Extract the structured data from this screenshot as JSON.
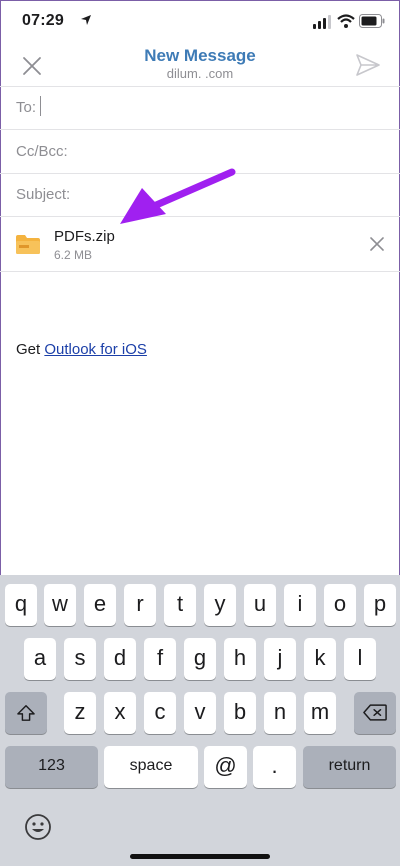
{
  "status_bar": {
    "time": "07:29"
  },
  "header": {
    "title": "New Message",
    "subtitle": "dilum.                   .com"
  },
  "fields": {
    "to_label": "To:",
    "cc_label": "Cc/Bcc:",
    "subject_label": "Subject:"
  },
  "attachment": {
    "name": "PDFs.zip",
    "size": "6.2 MB"
  },
  "signature": {
    "prefix": "Get ",
    "link": "Outlook for iOS"
  },
  "keyboard": {
    "row1": [
      "q",
      "w",
      "e",
      "r",
      "t",
      "y",
      "u",
      "i",
      "o",
      "p"
    ],
    "row2": [
      "a",
      "s",
      "d",
      "f",
      "g",
      "h",
      "j",
      "k",
      "l"
    ],
    "row3": [
      "z",
      "x",
      "c",
      "v",
      "b",
      "n",
      "m"
    ],
    "numbers": "123",
    "space": "space",
    "at": "@",
    "period": ".",
    "return": "return"
  },
  "colors": {
    "accent": "#3e7bb6",
    "link": "#1b3fa8",
    "arrow": "#a020f0"
  }
}
